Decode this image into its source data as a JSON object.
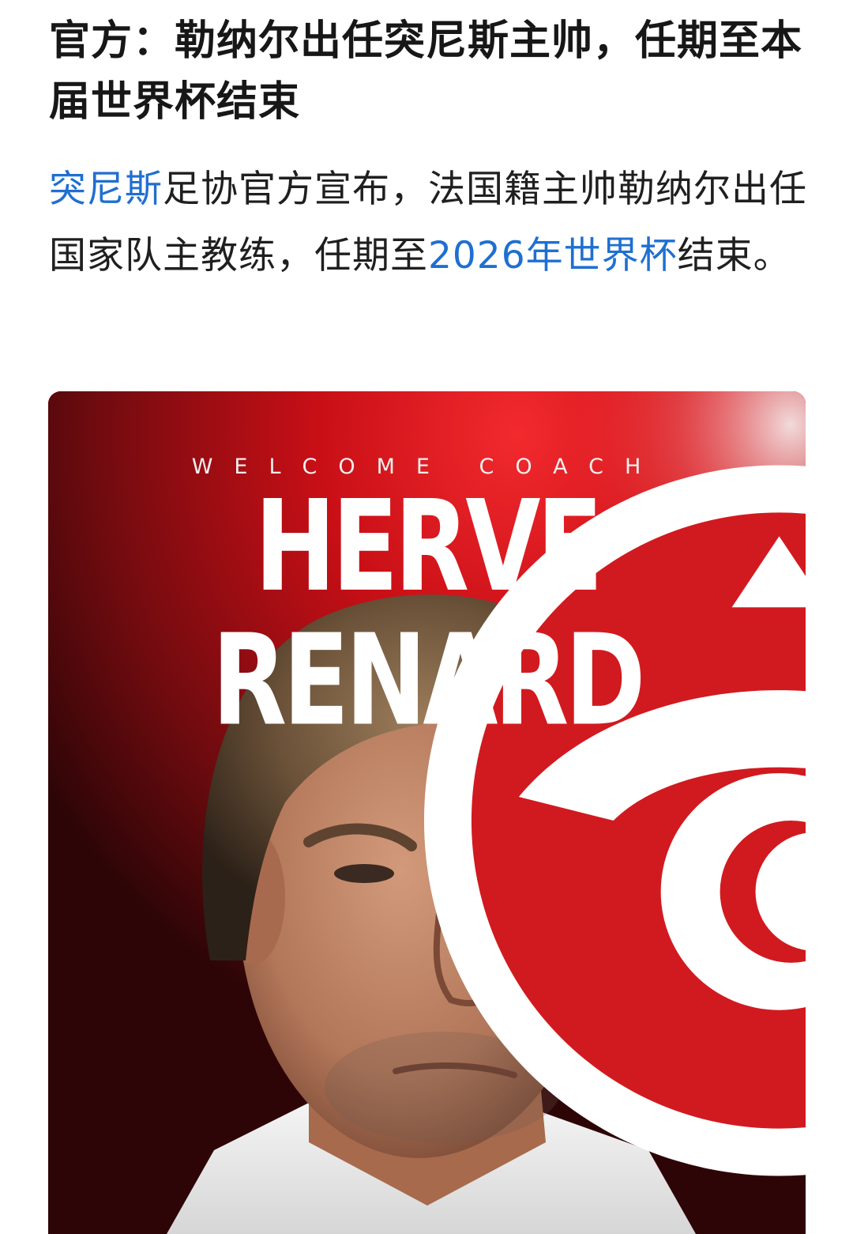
{
  "article": {
    "headline": "官方：勒纳尔出任突尼斯主帅，任期至本届世界杯结束",
    "body": {
      "link_1": "突尼斯",
      "text_1": "足协官方宣布，法国籍主帅勒纳尔出任国家队主教练，任期至",
      "link_2": "2026年世界杯",
      "text_2": "结束。"
    },
    "link_color": "#1f6fd1"
  },
  "poster": {
    "welcome_text": "WELCOME COACH",
    "coach_name": "HERVE RENARD",
    "crest_icon": "tunisia-football-federation-crest",
    "background_colors": [
      "#e0141c",
      "#6a0a0e",
      "#2a0507"
    ]
  }
}
